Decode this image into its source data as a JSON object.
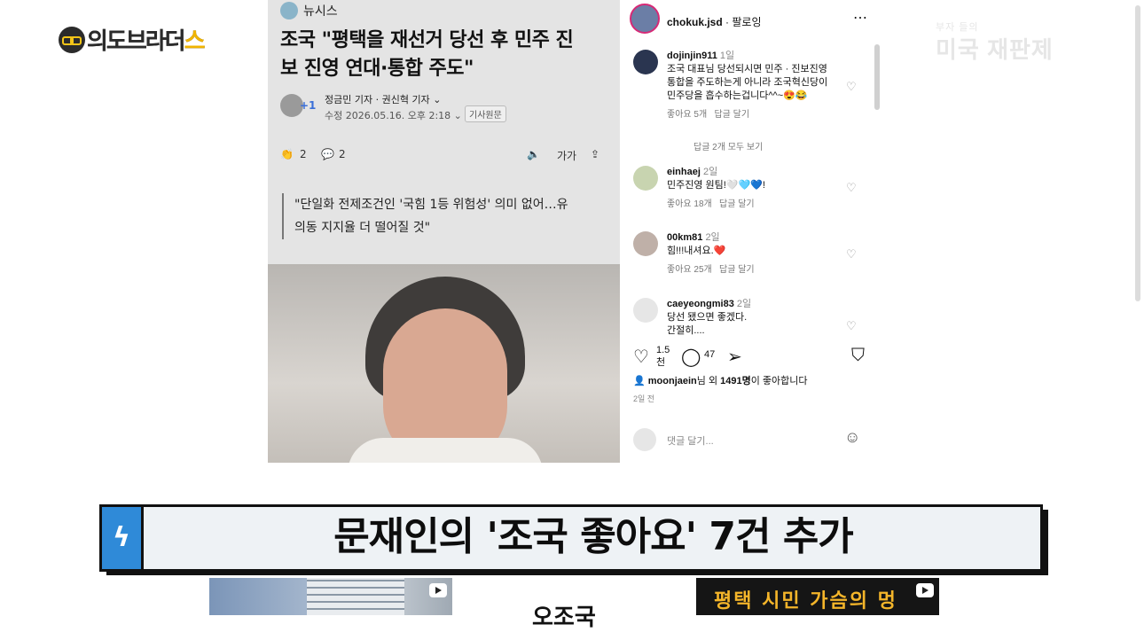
{
  "logo": {
    "text_dark": "의도브라더",
    "text_yellow": "스"
  },
  "watermark": {
    "small": "부자 들의",
    "big": "미국 재판제"
  },
  "article": {
    "source": "뉴시스",
    "headline_line1": "조국 \"평택을 재선거 당선 후 민주 진",
    "headline_line2": "보 진영 연대·통합 주도\"",
    "avatar_plus": "+1",
    "reporters": "정금민 기자 · 권신혁 기자",
    "datetime": "수정 2026.05.16. 오후 2:18",
    "original_label": "기사원문",
    "like_count": "2",
    "comment_count": "2",
    "font_label": "가가",
    "quote_line1": "\"단일화 전제조건인 '국힘 1등 위험성' 의미 없어…유",
    "quote_line2": "의동 지지율 더 떨어질 것\""
  },
  "instagram": {
    "username": "chokuk.jsd",
    "follow_label": "팔로잉",
    "more_icon": "⋯",
    "comments": [
      {
        "user": "dojinjin911",
        "age": "1일",
        "lines": [
          "조국 대표님 당선되시면 민주 · 진보진영",
          "통합을 주도하는게 아니라 조국혁신당이",
          "민주당을 흡수하는겁니다^^~😍😂"
        ],
        "likes": "좋아요 5개",
        "reply": "답글 달기"
      },
      {
        "user": "einhaej",
        "age": "2일",
        "lines": [
          "민주진영 원팀!🤍🩵💙!"
        ],
        "likes": "좋아요 18개",
        "reply": "답글 달기"
      },
      {
        "user": "00km81",
        "age": "2일",
        "lines": [
          "힘!!!내셔요.❤️"
        ],
        "likes": "좋아요 25개",
        "reply": "답글 달기"
      },
      {
        "user": "caeyeongmi83",
        "age": "2일",
        "lines": [
          "당선 됐으면 좋겠다.",
          "간절히...."
        ],
        "likes": "",
        "reply": ""
      }
    ],
    "more_replies": "답글 2개 모두 보기",
    "like_count": "1.5",
    "like_unit": "천",
    "comment_count": "47",
    "liked_by_user": "moonjaein",
    "liked_by_rest": "님 외 ",
    "liked_by_count": "1491명",
    "liked_by_tail": "이 좋아합니다",
    "post_age": "2일 전",
    "add_comment_placeholder": "댓글 달기..."
  },
  "banner": {
    "tag": "ϟ",
    "caption": "문재인의 '조국 좋아요' 7건 추가"
  },
  "thumbs": {
    "mid_title": "오조국",
    "right_text": "평택 시민 가슴의 멍"
  },
  "colors": {
    "banner_tag": "#2f8ad8",
    "banner_bg": "#eef2f5",
    "logo_yellow": "#f0b400",
    "insta_ring": "#d62976"
  }
}
